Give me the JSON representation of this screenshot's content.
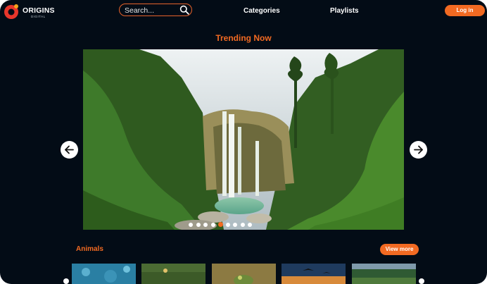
{
  "header": {
    "logo_name": "ORIGINS",
    "logo_sub": "DIGITAL",
    "search_placeholder": "Search...",
    "nav": [
      "Categories",
      "Playlists"
    ],
    "login_label": "Log in"
  },
  "hero": {
    "title": "Trending Now",
    "slide_count": 9,
    "active_slide": 5
  },
  "section": {
    "title": "Animals",
    "view_more_label": "View more"
  },
  "colors": {
    "accent": "#f26a22",
    "background": "#030c16"
  },
  "icons": [
    "search-icon",
    "arrow-left-icon",
    "arrow-right-icon"
  ]
}
